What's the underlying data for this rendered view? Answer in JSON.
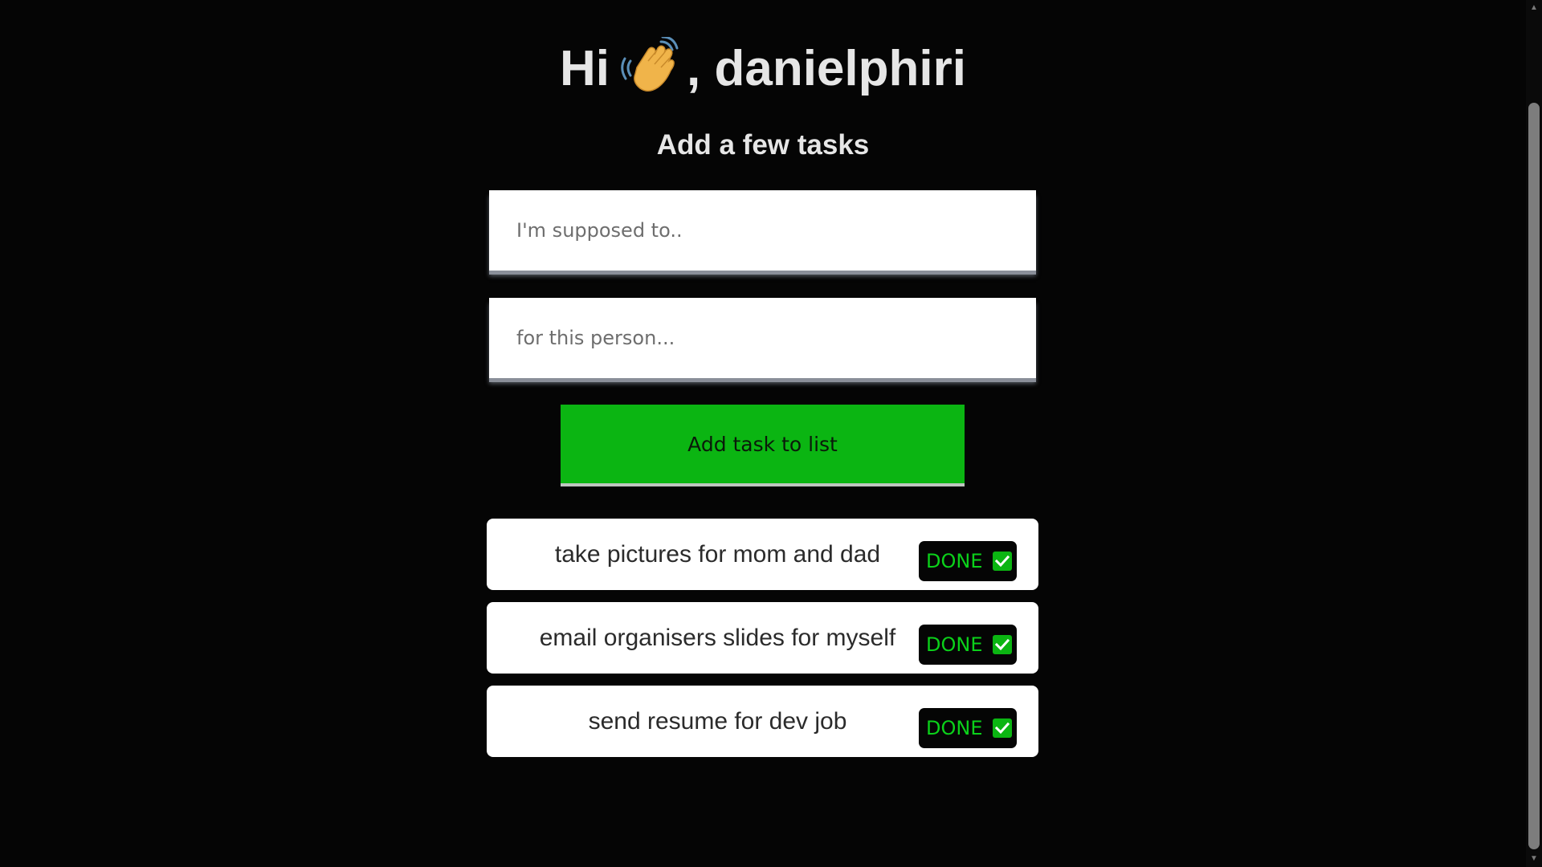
{
  "greeting": {
    "prefix": "Hi",
    "icon": "waving-hand-icon",
    "suffix": ", danielphiri"
  },
  "subtitle": "Add a few tasks",
  "form": {
    "task_placeholder": "I'm supposed to..",
    "task_value": "",
    "person_placeholder": "for this person...",
    "person_value": "",
    "add_button_label": "Add task to list"
  },
  "tasks": [
    {
      "text": "take pictures for mom and dad",
      "done_label": "DONE"
    },
    {
      "text": "email organisers slides for myself",
      "done_label": "DONE"
    },
    {
      "text": "send resume for dev job",
      "done_label": "DONE"
    }
  ],
  "colors": {
    "background": "#050505",
    "accent_green": "#0bb512",
    "done_text": "#0bd11a",
    "heading_text": "#e6e6e6"
  }
}
